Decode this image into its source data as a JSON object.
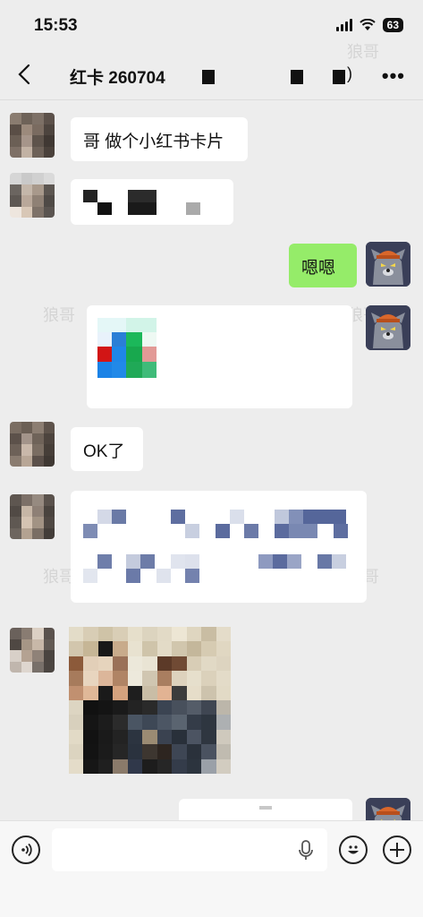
{
  "status_bar": {
    "time": "15:53",
    "battery": "63"
  },
  "header": {
    "title": "红卡 260704",
    "more": "•••"
  },
  "watermark": "狼哥",
  "messages": [
    {
      "id": 1,
      "side": "left",
      "text": "哥 做个小红书卡片"
    },
    {
      "id": 2,
      "side": "left",
      "text": ""
    },
    {
      "id": 3,
      "side": "right",
      "text": "嗯嗯"
    },
    {
      "id": 4,
      "side": "right",
      "text": ""
    },
    {
      "id": 5,
      "side": "left",
      "text": "OK了"
    },
    {
      "id": 6,
      "side": "left",
      "text": ""
    },
    {
      "id": 7,
      "side": "left",
      "text": ""
    },
    {
      "id": 8,
      "side": "right",
      "text": ""
    }
  ],
  "colors": {
    "chat_bg": "#ededed",
    "bubble_me": "#95ec69",
    "bubble_other": "#ffffff"
  }
}
